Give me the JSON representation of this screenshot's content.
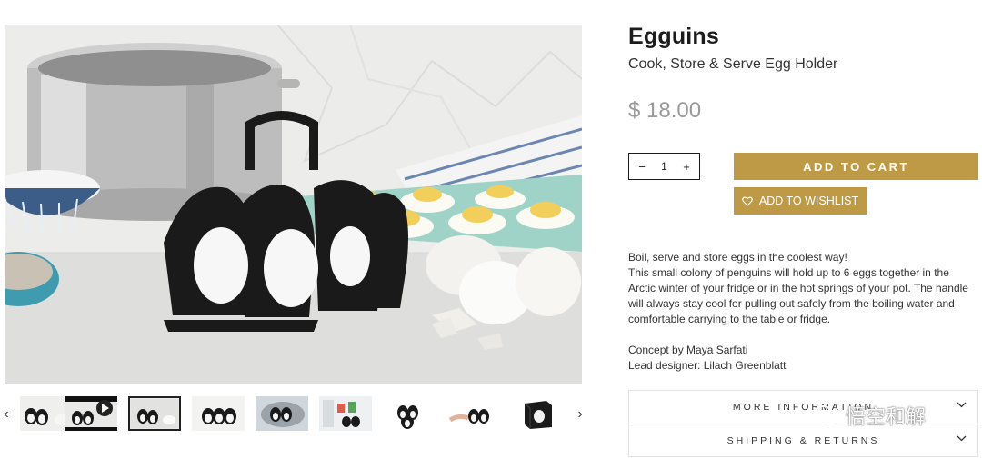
{
  "product": {
    "title": "Egguins",
    "subtitle": "Cook, Store & Serve Egg Holder",
    "price": "$ 18.00",
    "quantity": "1",
    "quantity_minus": "−",
    "quantity_plus": "+",
    "add_to_cart_label": "ADD TO CART",
    "wishlist_label": "ADD TO WISHLIST",
    "description_lines": [
      "Boil, serve and store eggs in the coolest way!",
      "This small colony of penguins will hold up to 6 eggs together in the Arctic winter of your fridge or in the hot springs of your pot. The handle will always stay cool for pulling out safely from the boiling water and comfortable carrying to the table or fridge."
    ],
    "credits": [
      "Concept by Maya Sarfati",
      "Lead designer: Lilach Greenblatt"
    ]
  },
  "accordion": [
    {
      "label": "MORE INFORMATION"
    },
    {
      "label": "SHIPPING & RETURNS"
    }
  ],
  "gallery": {
    "prev_arrow": "‹",
    "next_arrow": "›",
    "thumbnails": [
      {
        "name": "thumb-1",
        "active": false
      },
      {
        "name": "thumb-2-video",
        "active": false
      },
      {
        "name": "thumb-3",
        "active": true
      },
      {
        "name": "thumb-4",
        "active": false
      },
      {
        "name": "thumb-5",
        "active": false
      },
      {
        "name": "thumb-6",
        "active": false
      },
      {
        "name": "thumb-7",
        "active": false
      },
      {
        "name": "thumb-8",
        "active": false
      },
      {
        "name": "thumb-9-box",
        "active": false
      }
    ]
  },
  "watermark": {
    "text": "悟空和解"
  },
  "colors": {
    "accent": "#bf9a46",
    "price": "#9a9a9a",
    "text": "#222222"
  },
  "icons": {
    "heart": "heart-icon",
    "chevron": "chevron-down-icon",
    "play": "play-icon"
  }
}
